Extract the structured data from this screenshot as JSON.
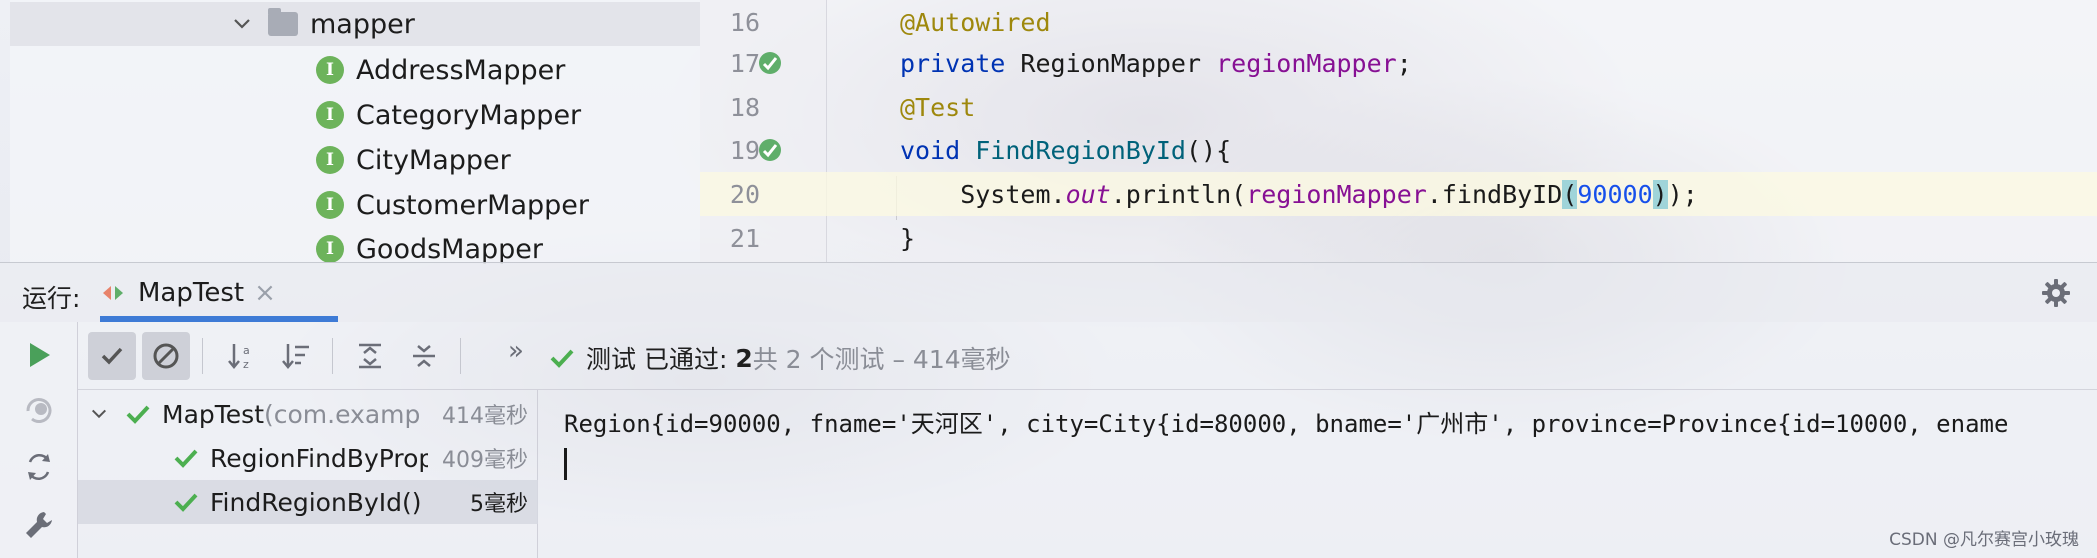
{
  "project_tree": {
    "folder": "mapper",
    "items": [
      "AddressMapper",
      "CategoryMapper",
      "CityMapper",
      "CustomerMapper",
      "GoodsMapper"
    ],
    "interface_badge": "I"
  },
  "editor": {
    "lines": [
      {
        "num": "16",
        "parts": [
          {
            "t": "@Autowired",
            "c": "ann"
          }
        ]
      },
      {
        "num": "17",
        "parts": [
          {
            "t": "private ",
            "c": "kw"
          },
          {
            "t": "RegionMapper ",
            "c": ""
          },
          {
            "t": "regionMapper",
            "c": "fld"
          },
          {
            "t": ";",
            "c": ""
          }
        ]
      },
      {
        "num": "18",
        "parts": [
          {
            "t": "@Test",
            "c": "ann"
          }
        ]
      },
      {
        "num": "19",
        "parts": [
          {
            "t": "void ",
            "c": "kw"
          },
          {
            "t": "FindRegionById",
            "c": "fn"
          },
          {
            "t": "(){",
            "c": ""
          }
        ]
      },
      {
        "num": "20",
        "parts": [
          {
            "t": "    System.",
            "c": ""
          },
          {
            "t": "out",
            "c": "ital"
          },
          {
            "t": ".println(",
            "c": ""
          },
          {
            "t": "regionMapper",
            "c": "fld"
          },
          {
            "t": ".findByID",
            "c": ""
          },
          {
            "t": "(",
            "c": "brace-hl"
          },
          {
            "t": "90000",
            "c": "num"
          },
          {
            "t": ")",
            "c": "brace-hl"
          },
          {
            "t": ");",
            "c": ""
          }
        ]
      },
      {
        "num": "21",
        "parts": [
          {
            "t": "}",
            "c": ""
          }
        ]
      }
    ]
  },
  "run_window": {
    "label": "运行:",
    "tab_title": "MapTest",
    "tab_close": "×",
    "status": {
      "prefix": "测试 已通过: ",
      "passed": "2",
      "suffix": "共 2 个测试 – 414毫秒"
    },
    "more": "»",
    "tests": [
      {
        "name": "MapTest",
        "pkg": " (com.examp",
        "time": "414毫秒",
        "level": 0
      },
      {
        "name": "RegionFindByProp",
        "pkg": "",
        "time": "409毫秒",
        "level": 1
      },
      {
        "name": "FindRegionById()",
        "pkg": "",
        "time": "5毫秒",
        "level": 1
      }
    ],
    "console_output": "Region{id=90000, fname='天河区', city=City{id=80000, bname='广州市', province=Province{id=10000, ename"
  },
  "watermark": "CSDN @凡尔赛宫小玫瑰",
  "colors": {
    "keyword": "#0033b3",
    "annotation": "#9e880d",
    "field": "#871094",
    "function": "#00627a",
    "number": "#1750eb",
    "pass_green": "#4caf50",
    "tab_accent": "#3e7bd6"
  }
}
